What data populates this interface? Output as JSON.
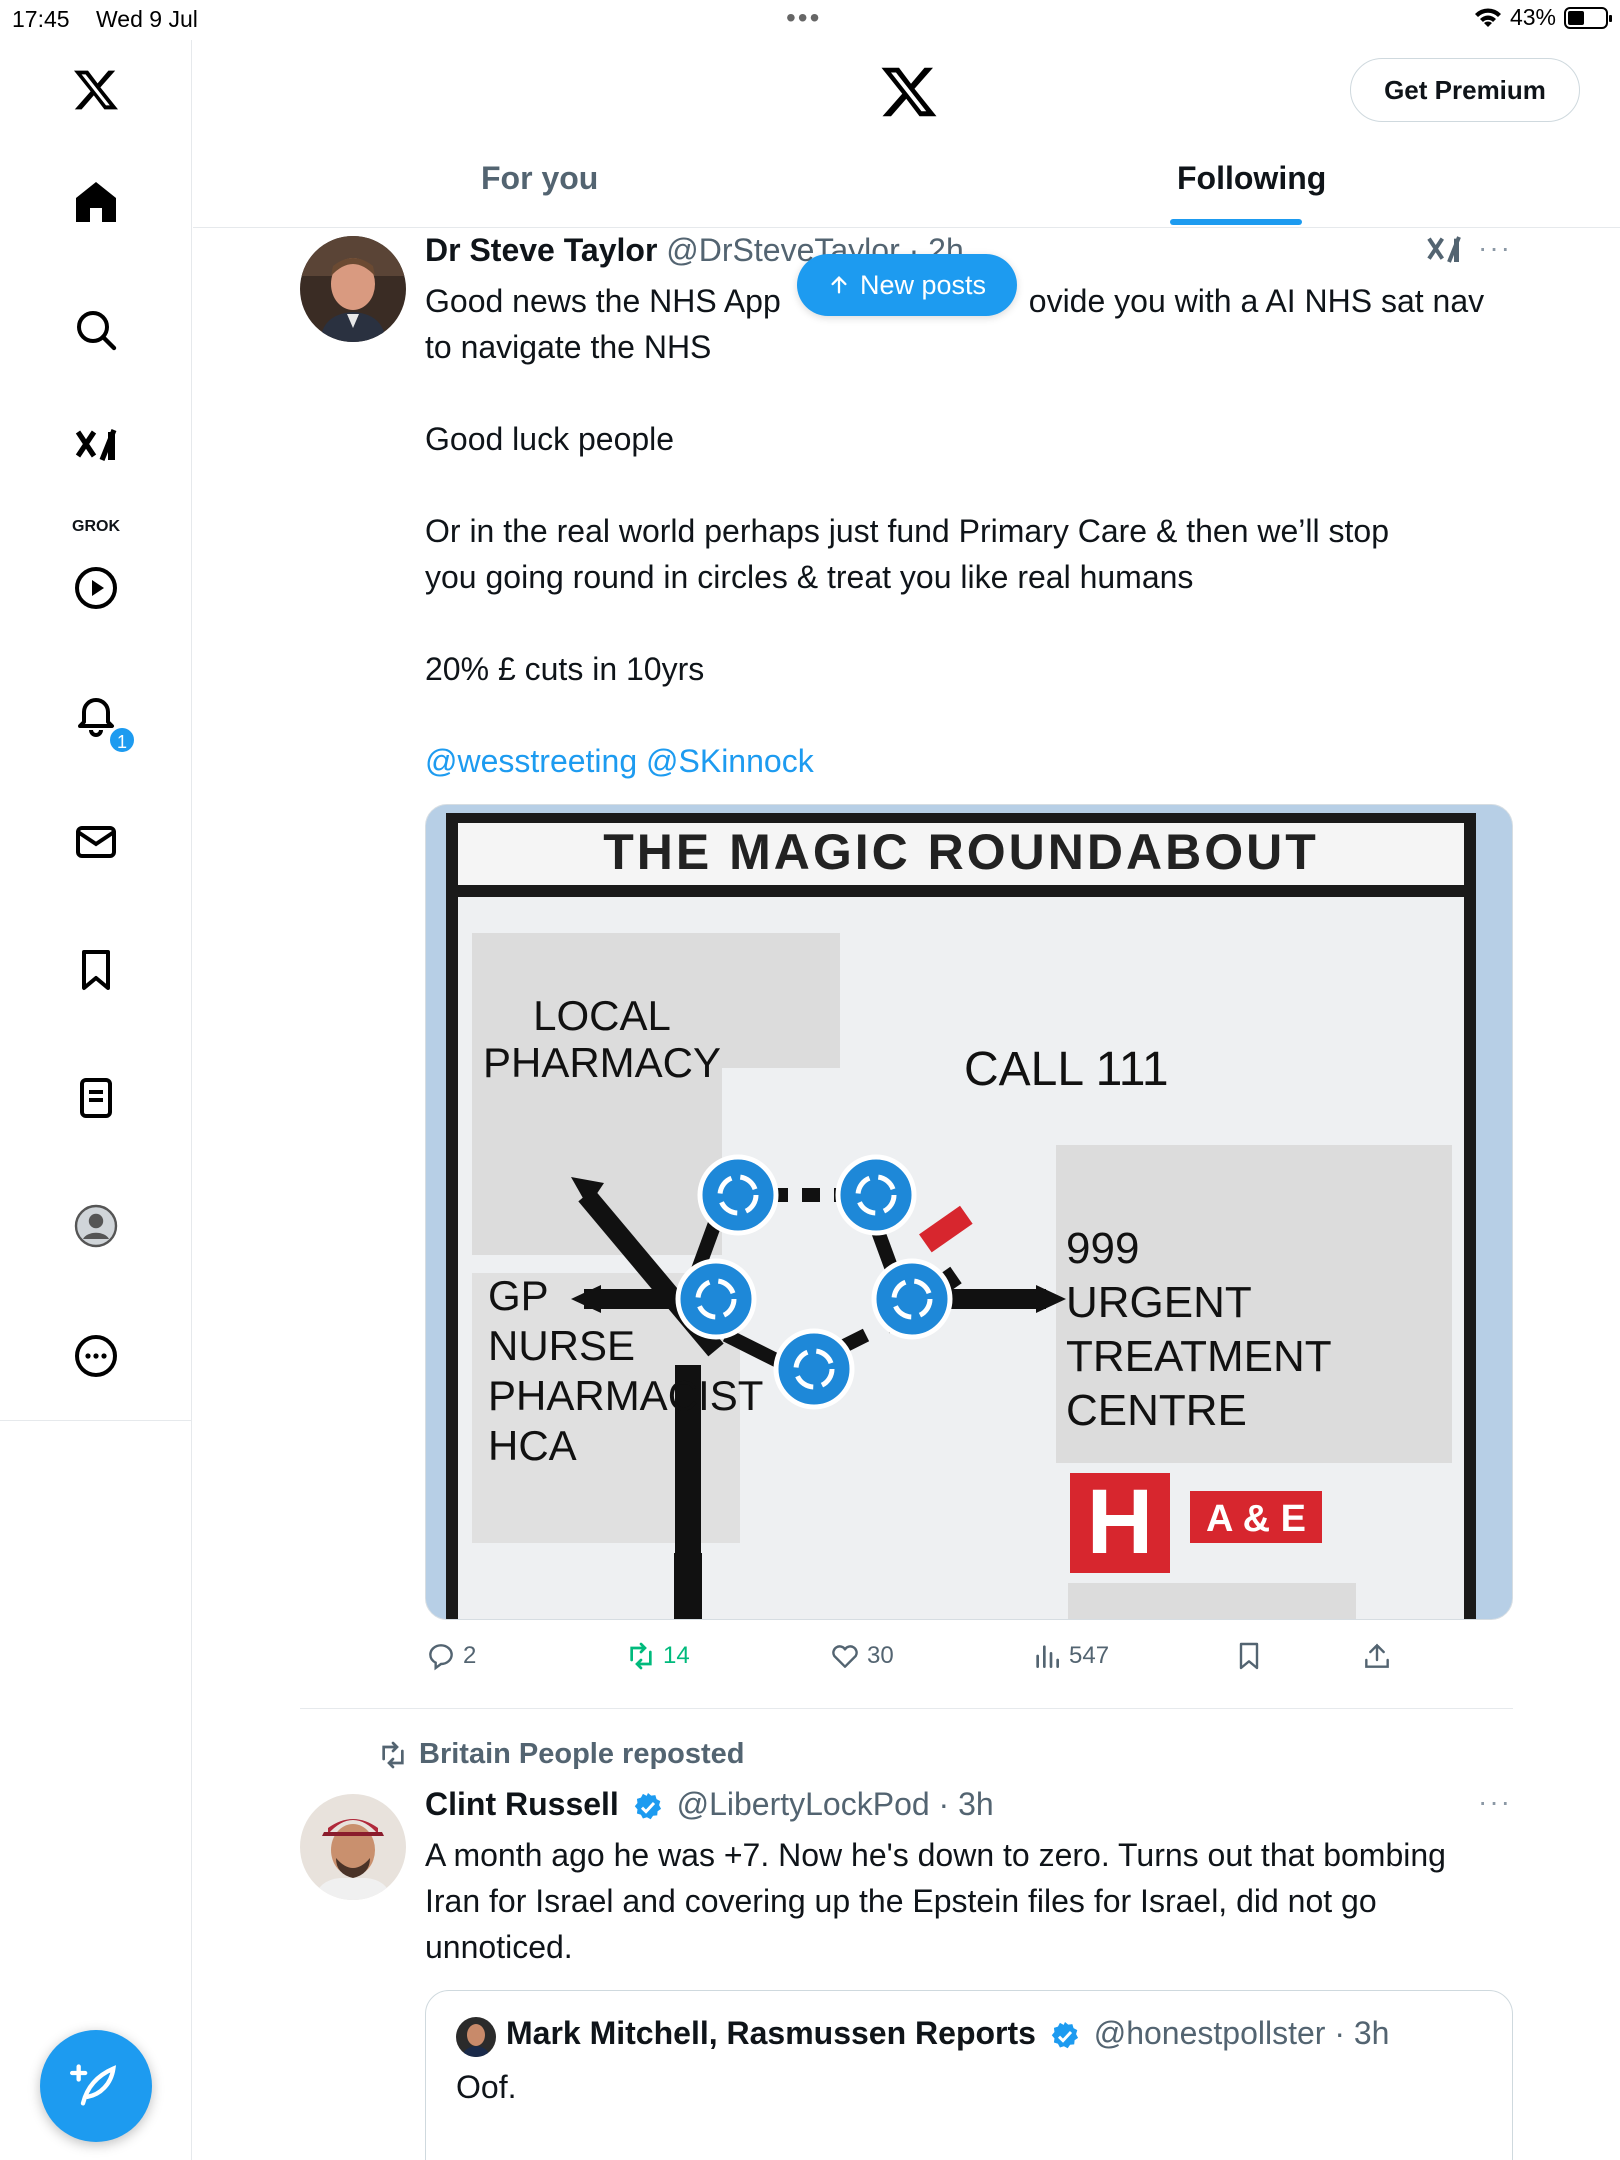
{
  "status_bar": {
    "time": "17:45",
    "date": "Wed 9 Jul",
    "battery": "43%"
  },
  "sidebar": {
    "grok_label": "GROK",
    "notification_count": "1",
    "items": [
      "home-icon",
      "search-icon",
      "grok-icon",
      "video-icon",
      "bell-icon",
      "mail-icon",
      "bookmark-icon",
      "list-icon",
      "profile-icon",
      "more-icon"
    ]
  },
  "header": {
    "premium_label": "Get Premium",
    "tabs": [
      {
        "label": "For you",
        "active": false
      },
      {
        "label": "Following",
        "active": true
      }
    ]
  },
  "new_posts_label": "New posts",
  "tweet1": {
    "name": "Dr Steve Taylor",
    "handle": "@DrSteveTaylor · 2h",
    "line1": "Good news the NHS App is going to provide you with a AI NHS sat nav",
    "line1_left": "Good news the NHS App",
    "line1_right": "ovide you with a AI NHS sat nav",
    "line2": "to navigate the NHS",
    "para2": "Good luck people",
    "para3_l1": "Or in the real world perhaps just fund Primary Care & then we’ll stop",
    "para3_l2": "you going round in circles & treat you like real humans",
    "para4": "20% £ cuts in 10yrs",
    "mentions": "@wesstreeting @SKinnock",
    "image": {
      "title": "THE MAGIC ROUNDABOUT",
      "local": "LOCAL",
      "pharmacy": "PHARMACY",
      "call": "CALL 111",
      "gp": "GP",
      "nurse": "NURSE",
      "pharmacist": "PHARMACIST",
      "hca": "HCA",
      "n999": "999",
      "urgent": "URGENT",
      "treatment": "TREATMENT",
      "centre": "CENTRE",
      "h": "H",
      "ae": "A & E"
    },
    "stats": {
      "replies": "2",
      "reposts": "14",
      "likes": "30",
      "views": "547"
    }
  },
  "tweet2": {
    "reposted_by": "Britain People reposted",
    "name": "Clint Russell",
    "handle": "@LibertyLockPod · 3h",
    "line1": "A month ago he was +7. Now he's down to zero. Turns out that bombing",
    "line2": "Iran for Israel and covering up the Epstein files for Israel, did not go",
    "line3": "unnoticed.",
    "quote": {
      "name": "Mark Mitchell, Rasmussen Reports",
      "handle": "@honestpollster · 3h",
      "text": "Oof."
    }
  },
  "colors": {
    "accent": "#1d9bf0",
    "repost_green": "#00ba7c",
    "secondary_text": "#536471"
  }
}
